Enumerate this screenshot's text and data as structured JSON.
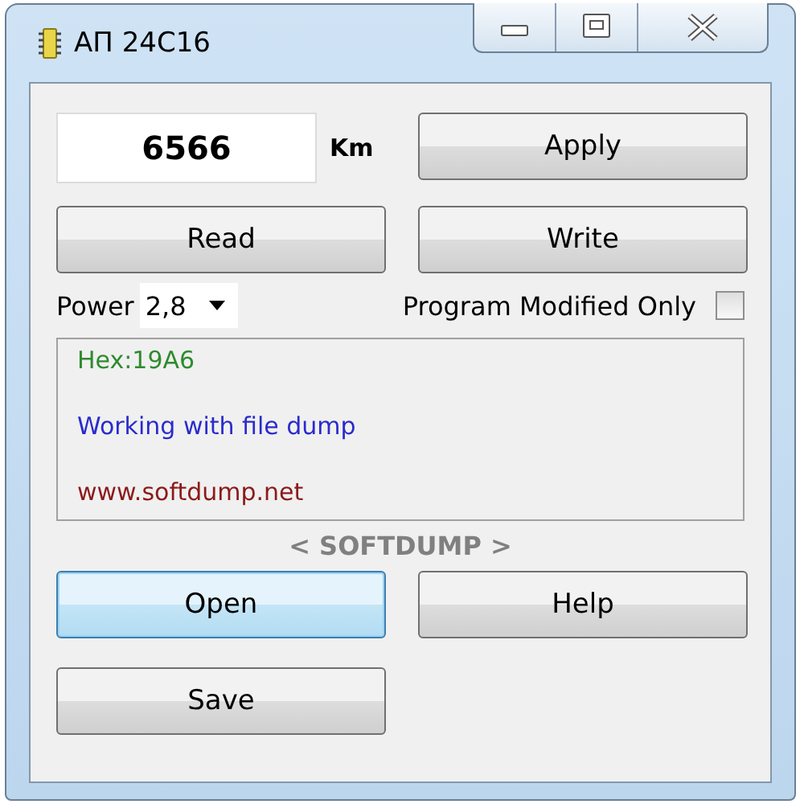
{
  "window": {
    "title": "АП 24C16"
  },
  "mileage": {
    "value": "6566",
    "unit": "Km"
  },
  "buttons": [
    {
      "label": "Apply",
      "focused": false
    },
    {
      "label": "Read",
      "focused": false
    },
    {
      "label": "Write",
      "focused": false
    }
  ],
  "power": {
    "label": "Power",
    "value": "2,8"
  },
  "program_modified_only": {
    "label": "Program Modified Only",
    "checked": false
  },
  "log": [
    {
      "text": "Hex:19A6",
      "color": "#2e8b2e"
    },
    {
      "text": "Working with file dump",
      "color": "#2b2bcc"
    },
    {
      "text": "www.softdump.net",
      "color": "#8b1a1a"
    }
  ],
  "brand": "< SOFTDUMP >",
  "bottom_buttons": [
    {
      "label": "Open",
      "focused": true
    },
    {
      "label": "Help",
      "focused": false
    },
    {
      "label": "Save",
      "focused": false
    }
  ]
}
